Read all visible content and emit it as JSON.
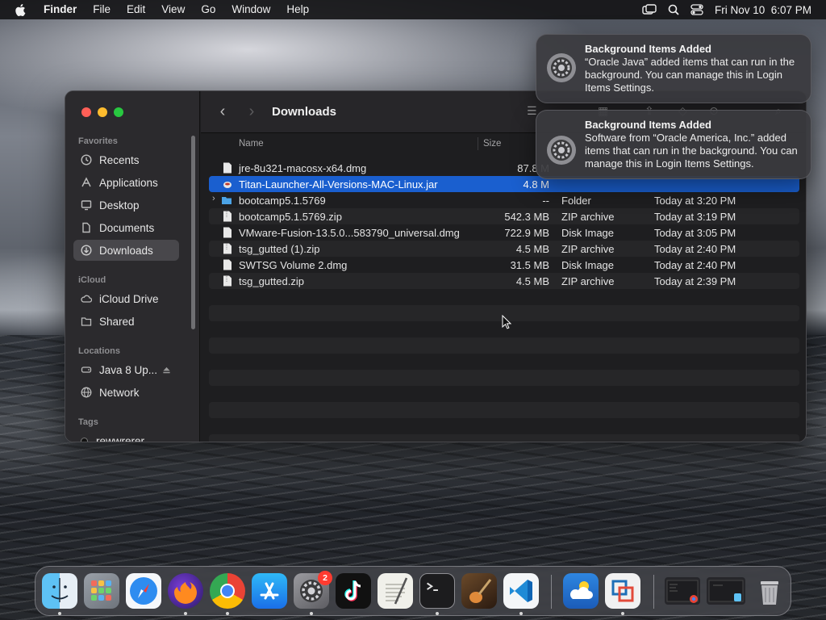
{
  "menubar": {
    "app": "Finder",
    "items": [
      "File",
      "Edit",
      "View",
      "Go",
      "Window",
      "Help"
    ],
    "datetime": "Fri Nov 10  6:07 PM"
  },
  "finder": {
    "title": "Downloads",
    "sidebar": {
      "favorites_label": "Favorites",
      "favorites": [
        "Recents",
        "Applications",
        "Desktop",
        "Documents",
        "Downloads"
      ],
      "icloud_label": "iCloud",
      "icloud": [
        "iCloud Drive",
        "Shared"
      ],
      "locations_label": "Locations",
      "locations": [
        "Java 8 Up...",
        "Network"
      ],
      "tags_label": "Tags",
      "tags": [
        "rewwrerer"
      ]
    },
    "columns": {
      "name": "Name",
      "size": "Size"
    },
    "files": [
      {
        "name": "jre-8u321-macosx-x64.dmg",
        "size": "87.8 M",
        "kind": "",
        "date": ""
      },
      {
        "name": "Titan-Launcher-All-Versions-MAC-Linux.jar",
        "size": "4.8 M",
        "kind": "",
        "date": ""
      },
      {
        "name": "bootcamp5.1.5769",
        "size": "--",
        "kind": "Folder",
        "date": "Today at 3:20 PM"
      },
      {
        "name": "bootcamp5.1.5769.zip",
        "size": "542.3 MB",
        "kind": "ZIP archive",
        "date": "Today at 3:19 PM"
      },
      {
        "name": "VMware-Fusion-13.5.0...583790_universal.dmg",
        "size": "722.9 MB",
        "kind": "Disk Image",
        "date": "Today at 3:05 PM"
      },
      {
        "name": "tsg_gutted (1).zip",
        "size": "4.5 MB",
        "kind": "ZIP archive",
        "date": "Today at 2:40 PM"
      },
      {
        "name": "SWTSG Volume 2.dmg",
        "size": "31.5 MB",
        "kind": "Disk Image",
        "date": "Today at 2:40 PM"
      },
      {
        "name": "tsg_gutted.zip",
        "size": "4.5 MB",
        "kind": "ZIP archive",
        "date": "Today at 2:39 PM"
      }
    ]
  },
  "notifications": [
    {
      "title": "Background Items Added",
      "body": "“Oracle Java” added items that can run in the background. You can manage this in Login Items Settings."
    },
    {
      "title": "Background Items Added",
      "body": "Software from “Oracle America, Inc.” added items that can run in the background. You can manage this in Login Items Settings."
    }
  ],
  "dock": {
    "settings_badge": "2"
  },
  "colors": {
    "selection": "#1a5fcf",
    "close": "#ff5f57",
    "minimize": "#febc2e",
    "zoom": "#28c840"
  }
}
